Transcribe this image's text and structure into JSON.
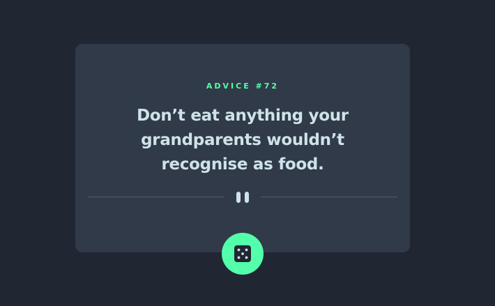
{
  "card": {
    "advice_label": "ADVICE #72",
    "quote": "Don’t eat anything your grandparents wouldn’t recognise as food."
  },
  "divider": {
    "icon": "pause-icon"
  },
  "dice_button": {
    "icon": "dice-icon"
  },
  "colors": {
    "background": "#202632",
    "card": "#313a48",
    "accent": "#53ffaa",
    "text": "#cee3e9",
    "divider": "#4f5d74"
  }
}
